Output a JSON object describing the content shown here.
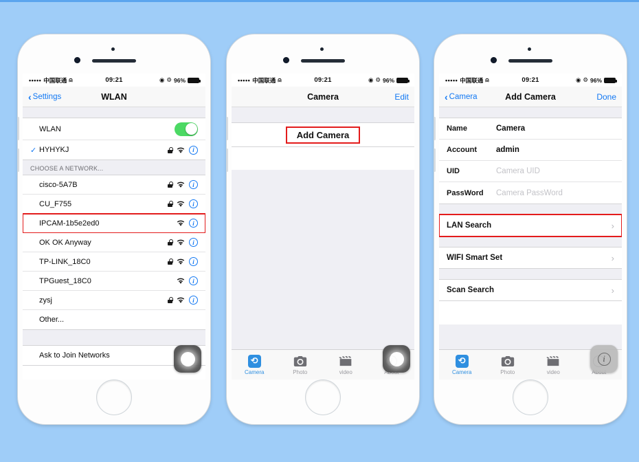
{
  "background_color": "#9fcdf8",
  "accent_blue": "#1278f3",
  "annotation_color": "#e31b1b",
  "toggle_on_color": "#4cd964",
  "status_bar": {
    "signal_dots": "•••••",
    "carrier": "中国联通",
    "wifi_icon": "wifi-icon",
    "time": "09:21",
    "rotation_lock_icon": "rotation-lock-icon",
    "alarm_icon": "alarm-icon",
    "battery_percent": "96%"
  },
  "phone1": {
    "nav": {
      "back_label": "Settings",
      "title": "WLAN"
    },
    "wlan_row": {
      "label": "WLAN",
      "toggle_on": true
    },
    "connected": {
      "label": "HYHYKJ",
      "checked": true,
      "locked": true
    },
    "section_header": "CHOOSE A NETWORK...",
    "networks": [
      {
        "ssid": "cisco-5A7B",
        "locked": true,
        "highlighted": false
      },
      {
        "ssid": "CU_F755",
        "locked": true,
        "highlighted": false
      },
      {
        "ssid": "IPCAM-1b5e2ed0",
        "locked": false,
        "highlighted": true
      },
      {
        "ssid": "OK OK Anyway",
        "locked": true,
        "highlighted": false
      },
      {
        "ssid": "TP-LINK_18C0",
        "locked": true,
        "highlighted": false
      },
      {
        "ssid": "TPGuest_18C0",
        "locked": false,
        "highlighted": false
      },
      {
        "ssid": "zysj",
        "locked": true,
        "highlighted": false
      }
    ],
    "other_label": "Other...",
    "ask_to_join": "Ask to Join Networks"
  },
  "phone2": {
    "nav": {
      "title": "Camera",
      "right_label": "Edit"
    },
    "add_camera_label": "Add Camera"
  },
  "phone3": {
    "nav": {
      "back_label": "Camera",
      "title": "Add Camera",
      "right_label": "Done"
    },
    "fields": [
      {
        "key": "Name",
        "value": "Camera",
        "placeholder": "",
        "is_placeholder": false
      },
      {
        "key": "Account",
        "value": "admin",
        "placeholder": "",
        "is_placeholder": false
      },
      {
        "key": "UID",
        "value": "Camera UID",
        "placeholder": "Camera UID",
        "is_placeholder": true
      },
      {
        "key": "PassWord",
        "value": "Camera PassWord",
        "placeholder": "Camera PassWord",
        "is_placeholder": true
      }
    ],
    "actions": [
      {
        "label": "LAN Search",
        "highlighted": true
      },
      {
        "label": "WIFI Smart Set",
        "highlighted": false
      },
      {
        "label": "Scan Search",
        "highlighted": false
      }
    ]
  },
  "tabbar": {
    "tabs": [
      {
        "label": "Camera",
        "icon": "camera-app-icon",
        "active": true
      },
      {
        "label": "Photo",
        "icon": "photo-icon",
        "active": false
      },
      {
        "label": "video",
        "icon": "video-icon",
        "active": false
      },
      {
        "label": "About",
        "icon": "info-icon",
        "active": false
      }
    ]
  }
}
